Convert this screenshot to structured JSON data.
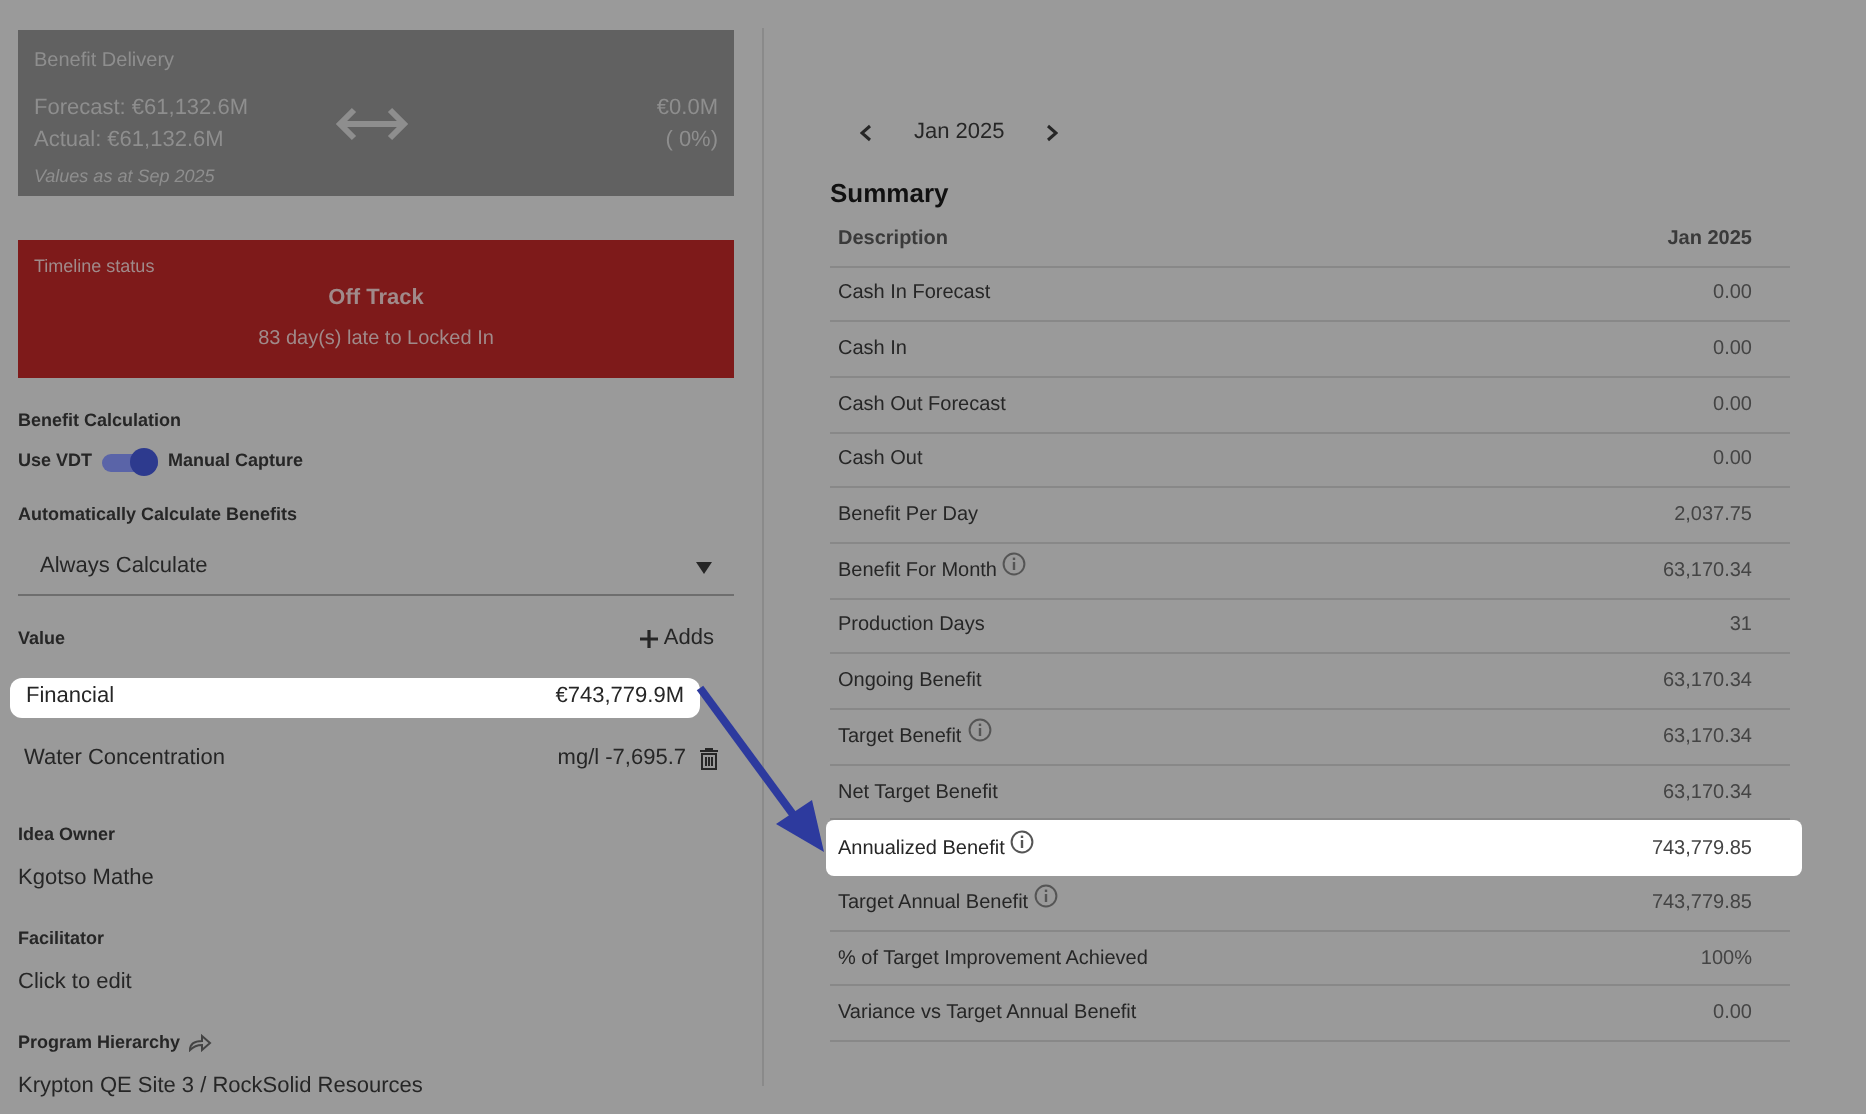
{
  "benefit_delivery": {
    "title": "Benefit Delivery",
    "forecast": "Forecast: €61,132.6M",
    "actual": "Actual: €61,132.6M",
    "variance": "€0.0M",
    "variance_percent": "( 0%)",
    "note": "Values as at Sep 2025"
  },
  "timeline_status": {
    "title": "Timeline status",
    "status": "Off Track",
    "detail": "83 day(s) late to Locked In"
  },
  "benefit_calculation": {
    "label": "Benefit Calculation",
    "toggle_left": "Use VDT",
    "toggle_right": "Manual Capture",
    "on": true
  },
  "auto_calculate": {
    "label": "Automatically Calculate Benefits",
    "value": "Always Calculate"
  },
  "values": {
    "label": "Value",
    "add_button": "Adds",
    "items": [
      {
        "name": "Financial",
        "amount": "€743,779.9M",
        "highlighted": true,
        "deletable": false
      },
      {
        "name": "Water Concentration",
        "amount": "mg/l -7,695.7",
        "highlighted": false,
        "deletable": true
      }
    ]
  },
  "idea_owner": {
    "label": "Idea Owner",
    "value": "Kgotso Mathe"
  },
  "facilitator": {
    "label": "Facilitator",
    "value": "Click to edit"
  },
  "program_hierarchy": {
    "label": "Program Hierarchy",
    "value": "Krypton QE Site 3 / RockSolid Resources"
  },
  "period": {
    "label": "Jan 2025"
  },
  "summary": {
    "title": "Summary",
    "columns": [
      "Description",
      "Jan 2025"
    ],
    "rows": [
      {
        "label": "Cash In Forecast",
        "value": "0.00",
        "info": false,
        "highlighted": false
      },
      {
        "label": "Cash In",
        "value": "0.00",
        "info": false,
        "highlighted": false
      },
      {
        "label": "Cash Out Forecast",
        "value": "0.00",
        "info": false,
        "highlighted": false
      },
      {
        "label": "Cash Out",
        "value": "0.00",
        "info": false,
        "highlighted": false
      },
      {
        "label": "Benefit Per Day",
        "value": "2,037.75",
        "info": false,
        "highlighted": false
      },
      {
        "label": "Benefit For Month",
        "value": "63,170.34",
        "info": true,
        "highlighted": false
      },
      {
        "label": "Production Days",
        "value": "31",
        "info": false,
        "highlighted": false
      },
      {
        "label": "Ongoing Benefit",
        "value": "63,170.34",
        "info": false,
        "highlighted": false
      },
      {
        "label": "Target Benefit",
        "value": "63,170.34",
        "info": true,
        "highlighted": false
      },
      {
        "label": "Net Target Benefit",
        "value": "63,170.34",
        "info": false,
        "highlighted": false
      },
      {
        "label": "Annualized Benefit",
        "value": "743,779.85",
        "info": true,
        "highlighted": true
      },
      {
        "label": "Target Annual Benefit",
        "value": "743,779.85",
        "info": true,
        "highlighted": false
      },
      {
        "label": "% of Target Improvement Achieved",
        "value": "100%",
        "info": false,
        "highlighted": false
      },
      {
        "label": "Variance vs Target Annual Benefit",
        "value": "0.00",
        "info": false,
        "highlighted": false
      }
    ]
  }
}
